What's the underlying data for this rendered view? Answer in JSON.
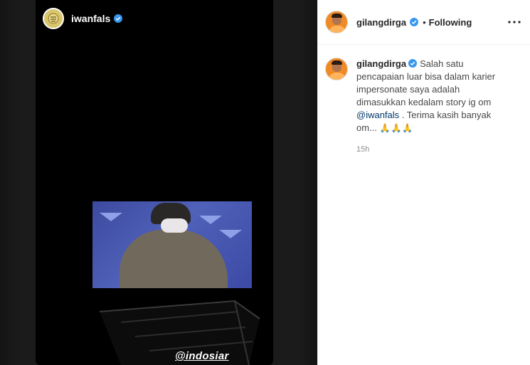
{
  "story": {
    "username": "iwanfals",
    "verified": true,
    "tag": "@indosiar"
  },
  "post": {
    "author": "gilangdirga",
    "verified": true,
    "separator": "•",
    "follow_state": "Following",
    "more_icon": "more-horizontal-icon",
    "caption": {
      "username": "gilangdirga",
      "text_before": "Salah satu pencapaian luar bisa dalam karier impersonate saya adalah dimasukkan kedalam story ig om ",
      "mention": "@iwanfals",
      "text_after": " . Terima kasih banyak om... ",
      "emojis": "🙏🙏🙏"
    },
    "time": "15h"
  },
  "colors": {
    "verified_blue": "#3897f0",
    "mention": "#00376b",
    "muted": "#8e8e8e"
  }
}
